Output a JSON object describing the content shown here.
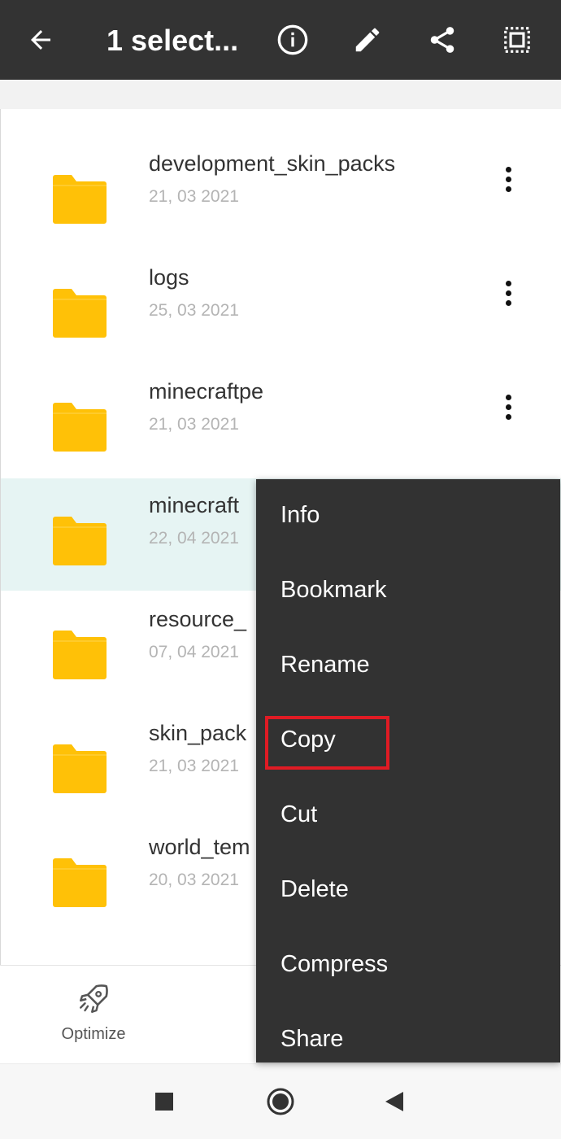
{
  "header": {
    "title": "1 select...",
    "icons": [
      "back-arrow-icon",
      "info-icon",
      "edit-pencil-icon",
      "share-icon",
      "select-all-icon"
    ]
  },
  "files": [
    {
      "name": "development_skin_packs",
      "date": "21, 03 2021",
      "selected": false
    },
    {
      "name": "logs",
      "date": "25, 03 2021",
      "selected": false
    },
    {
      "name": "minecraftpe",
      "date": "21, 03 2021",
      "selected": false
    },
    {
      "name": "minecraft",
      "date": "22, 04 2021",
      "selected": true
    },
    {
      "name": "resource_",
      "date": "07, 04 2021",
      "selected": false
    },
    {
      "name": "skin_pack",
      "date": "21, 03 2021",
      "selected": false
    },
    {
      "name": "world_tem",
      "date": "20, 03 2021",
      "selected": false
    }
  ],
  "context_menu": {
    "items": [
      "Info",
      "Bookmark",
      "Rename",
      "Copy",
      "Cut",
      "Delete",
      "Compress",
      "Share"
    ],
    "highlighted": "Copy"
  },
  "bottom_bar": {
    "optimize_label": "Optimize"
  },
  "colors": {
    "appbar": "#333333",
    "folder": "#FFC107",
    "selected_row": "#e6f4f3",
    "menu_bg": "#323232",
    "highlight_border": "#e01b24"
  }
}
